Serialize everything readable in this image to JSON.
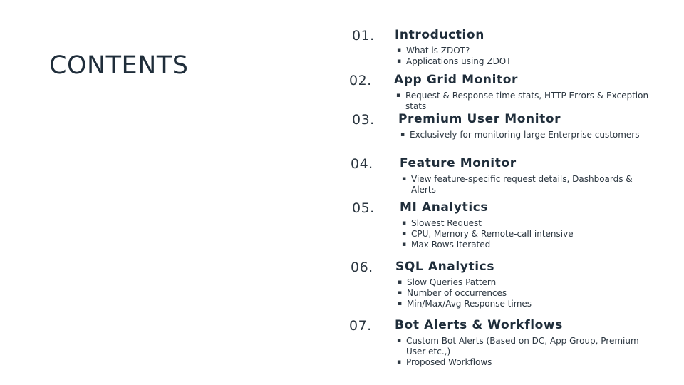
{
  "title": "CONTENTS",
  "sections": [
    {
      "number": "01.",
      "heading": "Introduction",
      "bullets": [
        "What is ZDOT?",
        "Applications using ZDOT"
      ]
    },
    {
      "number": "02.",
      "heading": "App Grid Monitor",
      "bullets": [
        "Request & Response time stats, HTTP Errors & Exception stats"
      ]
    },
    {
      "number": "03.",
      "heading": "Premium User Monitor",
      "bullets": [
        "Exclusively for monitoring large Enterprise customers"
      ]
    },
    {
      "number": "04.",
      "heading": "Feature Monitor",
      "bullets": [
        "View feature-specific request details, Dashboards & Alerts"
      ]
    },
    {
      "number": "05.",
      "heading": "MI Analytics",
      "bullets": [
        "Slowest Request",
        "CPU, Memory & Remote-call intensive",
        "Max Rows Iterated"
      ]
    },
    {
      "number": "06.",
      "heading": "SQL Analytics",
      "bullets": [
        "Slow Queries Pattern",
        "Number of occurrences",
        "Min/Max/Avg Response times"
      ]
    },
    {
      "number": "07.",
      "heading": "Bot Alerts & Workflows",
      "bullets": [
        "Custom Bot Alerts (Based on DC, App Group, Premium User etc.,)",
        "Proposed Workflows"
      ]
    }
  ]
}
